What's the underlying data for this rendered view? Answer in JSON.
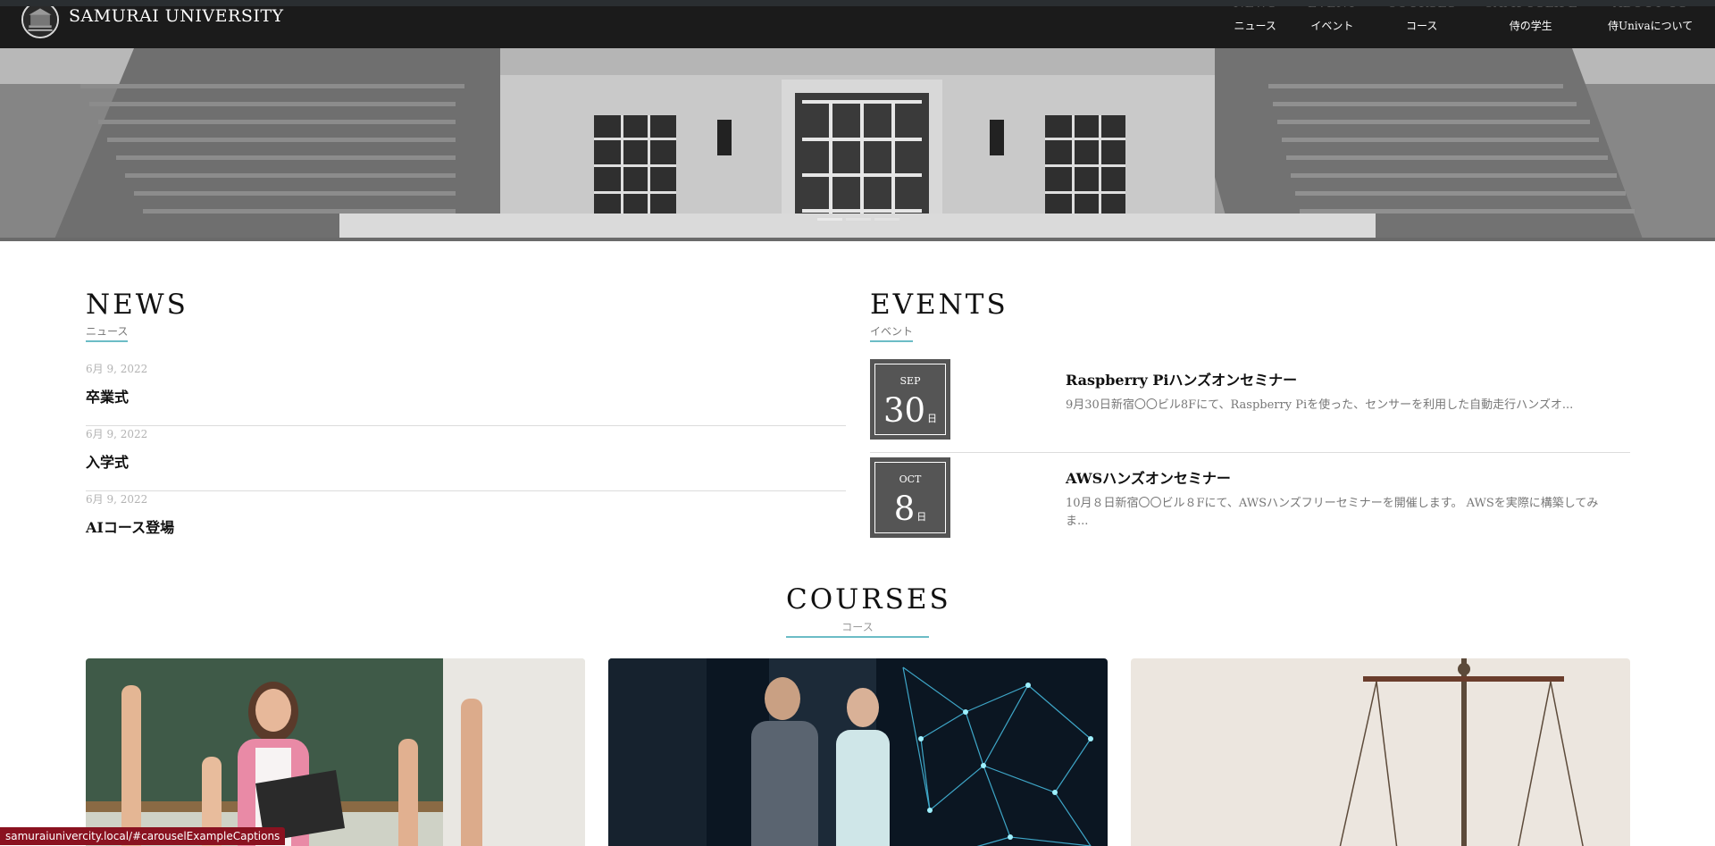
{
  "brand": {
    "name": "SAMURAI UNIVERSITY",
    "logo_icon": "university-crest-icon"
  },
  "nav": [
    {
      "en": "NEWS",
      "jp": "ニュース"
    },
    {
      "en": "EVENT",
      "jp": "イベント"
    },
    {
      "en": "COURSES",
      "jp": "コース"
    },
    {
      "en": "CAMPUSLIFE",
      "jp": "侍の学生"
    },
    {
      "en": "ABOUT US",
      "jp": "侍Univaについて"
    }
  ],
  "hero": {
    "image": "university-building-steps-photo",
    "slide_count": 3,
    "active_slide": 1
  },
  "news": {
    "title": "NEWS",
    "subtitle": "ニュース",
    "items": [
      {
        "date": "6月 9, 2022",
        "title": "卒業式"
      },
      {
        "date": "6月 9, 2022",
        "title": "入学式"
      },
      {
        "date": "6月 9, 2022",
        "title": "AIコース登場"
      }
    ]
  },
  "events": {
    "title": "EVENTS",
    "subtitle": "イベント",
    "day_suffix": "日",
    "items": [
      {
        "month": "SEP",
        "day": "30",
        "title": "Raspberry Piハンズオンセミナー",
        "desc": "9月30日新宿〇〇ビル8Fにて、Raspberry Piを使った、センサーを利用した自動走行ハンズオ..."
      },
      {
        "month": "OCT",
        "day": "8",
        "title": "AWSハンズオンセミナー",
        "desc": "10月８日新宿〇〇ビル８Fにて、AWSハンズフリーセミナーを開催します。 AWSを実際に構築してみま..."
      }
    ]
  },
  "courses": {
    "title": "COURSES",
    "subtitle": "コース",
    "cards": [
      {
        "image": "teacher-classroom-photo"
      },
      {
        "image": "server-room-network-photo"
      },
      {
        "image": "justice-scale-photo"
      }
    ]
  },
  "status_url": "samuraiunivercity.local/#carouselExampleCaptions",
  "colors": {
    "accent_underline": "#6cbcc6",
    "header_bg": "#0a0a0a",
    "calendar_bg": "#555555",
    "status_bg": "#8a1220"
  }
}
